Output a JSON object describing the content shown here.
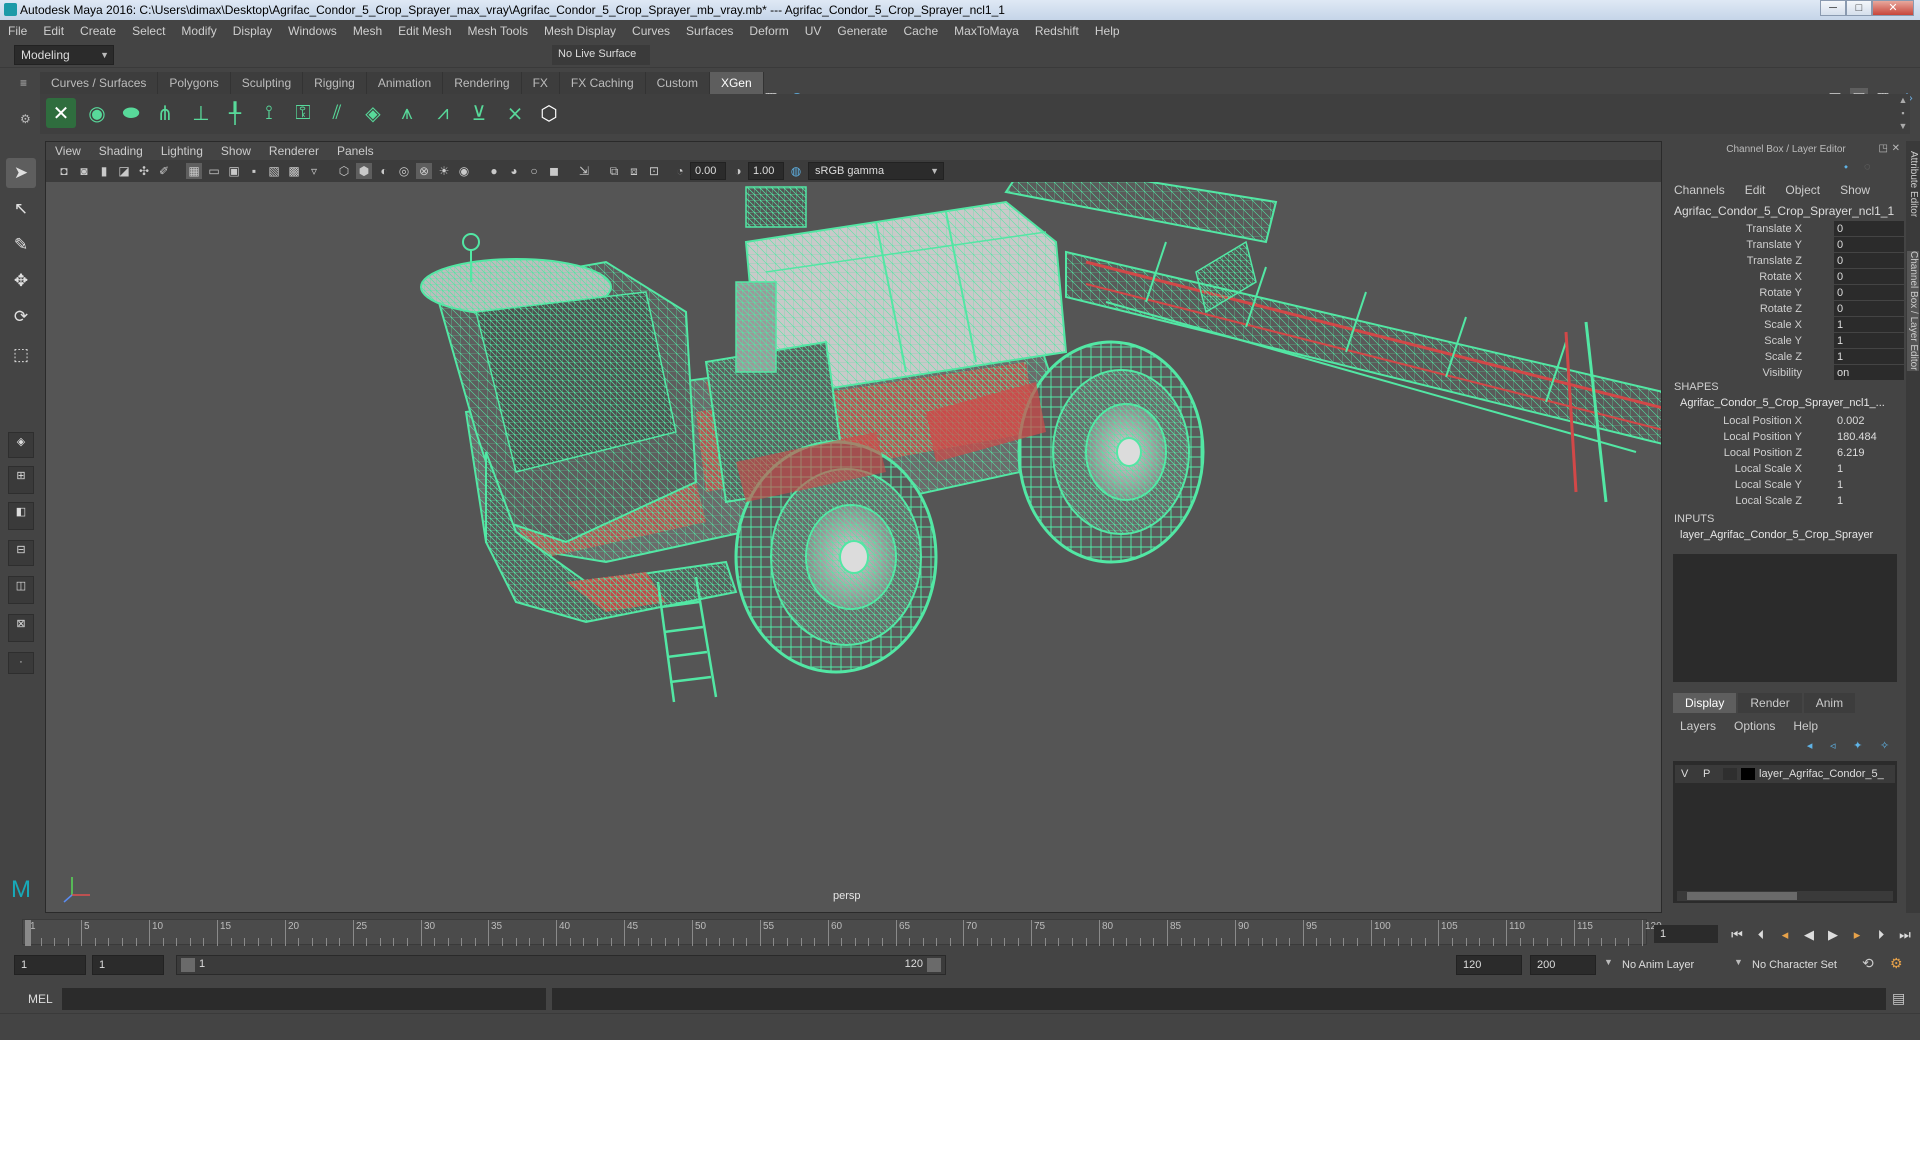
{
  "window": {
    "title": "Autodesk Maya 2016: C:\\Users\\dimax\\Desktop\\Agrifac_Condor_5_Crop_Sprayer_max_vray\\Agrifac_Condor_5_Crop_Sprayer_mb_vray.mb*   ---   Agrifac_Condor_5_Crop_Sprayer_ncl1_1",
    "minimize": "─",
    "maximize": "□",
    "close": "✕"
  },
  "menubar": [
    "File",
    "Edit",
    "Create",
    "Select",
    "Modify",
    "Display",
    "Windows",
    "Mesh",
    "Edit Mesh",
    "Mesh Tools",
    "Mesh Display",
    "Curves",
    "Surfaces",
    "Deform",
    "UV",
    "Generate",
    "Cache",
    "MaxToMaya",
    "Redshift",
    "Help"
  ],
  "statusline": {
    "mode": "Modeling",
    "live_surface": "No Live Surface"
  },
  "shelf_tabs": [
    {
      "label": "Curves / Surfaces",
      "active": false
    },
    {
      "label": "Polygons",
      "active": false
    },
    {
      "label": "Sculpting",
      "active": false
    },
    {
      "label": "Rigging",
      "active": false
    },
    {
      "label": "Animation",
      "active": false
    },
    {
      "label": "Rendering",
      "active": false
    },
    {
      "label": "FX",
      "active": false
    },
    {
      "label": "FX Caching",
      "active": false
    },
    {
      "label": "Custom",
      "active": false
    },
    {
      "label": "XGen",
      "active": true
    }
  ],
  "viewport": {
    "menu": [
      "View",
      "Shading",
      "Lighting",
      "Show",
      "Renderer",
      "Panels"
    ],
    "exposure": "0.00",
    "gamma": "1.00",
    "color_space": "sRGB gamma",
    "camera_label": "persp"
  },
  "channel_box": {
    "title": "Channel Box / Layer Editor",
    "menu": [
      "Channels",
      "Edit",
      "Object",
      "Show"
    ],
    "object": "Agrifac_Condor_5_Crop_Sprayer_ncl1_1",
    "channels": [
      {
        "label": "Translate X",
        "value": "0"
      },
      {
        "label": "Translate Y",
        "value": "0"
      },
      {
        "label": "Translate Z",
        "value": "0"
      },
      {
        "label": "Rotate X",
        "value": "0"
      },
      {
        "label": "Rotate Y",
        "value": "0"
      },
      {
        "label": "Rotate Z",
        "value": "0"
      },
      {
        "label": "Scale X",
        "value": "1"
      },
      {
        "label": "Scale Y",
        "value": "1"
      },
      {
        "label": "Scale Z",
        "value": "1"
      },
      {
        "label": "Visibility",
        "value": "on"
      }
    ],
    "shapes_header": "SHAPES",
    "shape_name": "Agrifac_Condor_5_Crop_Sprayer_ncl1_...",
    "shape_attrs": [
      {
        "label": "Local Position X",
        "value": "0.002"
      },
      {
        "label": "Local Position Y",
        "value": "180.484"
      },
      {
        "label": "Local Position Z",
        "value": "6.219"
      },
      {
        "label": "Local Scale X",
        "value": "1"
      },
      {
        "label": "Local Scale Y",
        "value": "1"
      },
      {
        "label": "Local Scale Z",
        "value": "1"
      }
    ],
    "inputs_header": "INPUTS",
    "input_name": "layer_Agrifac_Condor_5_Crop_Sprayer"
  },
  "layer_editor": {
    "tabs": [
      {
        "label": "Display",
        "active": true
      },
      {
        "label": "Render",
        "active": false
      },
      {
        "label": "Anim",
        "active": false
      }
    ],
    "menu": [
      "Layers",
      "Options",
      "Help"
    ],
    "layer": {
      "v": "V",
      "p": "P",
      "name": "layer_Agrifac_Condor_5_"
    }
  },
  "side_tabs": [
    "Attribute Editor",
    "Channel Box / Layer Editor"
  ],
  "timeline": {
    "ticks": [
      "1",
      "5",
      "10",
      "15",
      "20",
      "25",
      "30",
      "35",
      "40",
      "45",
      "50",
      "55",
      "60",
      "65",
      "70",
      "75",
      "80",
      "85",
      "90",
      "95",
      "100",
      "105",
      "110",
      "115",
      "120"
    ],
    "current_frame": "1"
  },
  "range": {
    "start": "1",
    "playback_start": "1",
    "slider_start": "1",
    "slider_end": "120",
    "playback_end": "120",
    "end": "200",
    "anim_layer": "No Anim Layer",
    "character_set": "No Character Set"
  },
  "command": {
    "label": "MEL"
  },
  "colors": {
    "wire": "#52e7a4",
    "red": "#d24848",
    "background": "#555555"
  }
}
